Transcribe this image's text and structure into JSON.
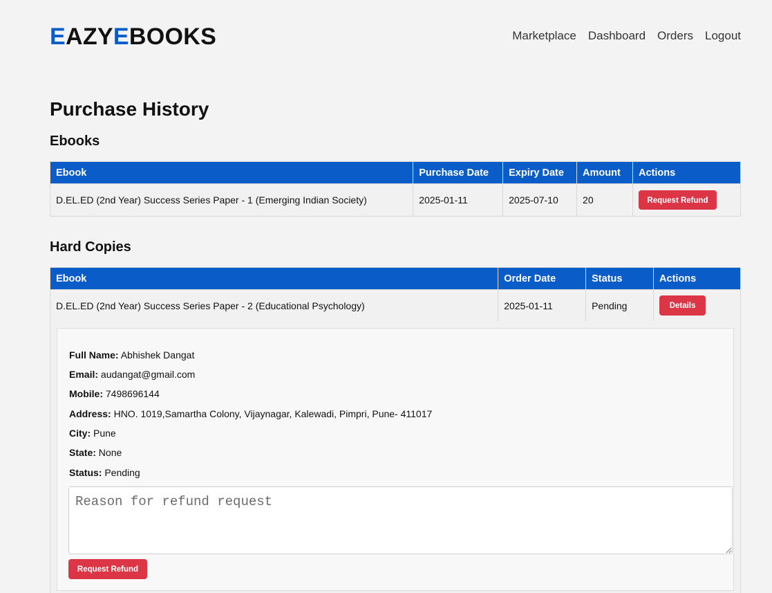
{
  "brand": {
    "logo_e1": "E",
    "logo_mid1": "AZY",
    "logo_e2": "E",
    "logo_mid2": "BOOKS",
    "accent_color": "#0a5cc9"
  },
  "nav": {
    "items": [
      "Marketplace",
      "Dashboard",
      "Orders",
      "Logout"
    ]
  },
  "page_title": "Purchase History",
  "ebooks": {
    "heading": "Ebooks",
    "columns": [
      "Ebook",
      "Purchase Date",
      "Expiry Date",
      "Amount",
      "Actions"
    ],
    "rows": [
      {
        "ebook": "D.EL.ED (2nd Year) Success Series Paper - 1 (Emerging Indian Society)",
        "purchase_date": "2025-01-11",
        "expiry_date": "2025-07-10",
        "amount": "20",
        "action_label": "Request Refund"
      }
    ]
  },
  "hard_copies": {
    "heading": "Hard Copies",
    "columns": [
      "Ebook",
      "Order Date",
      "Status",
      "Actions"
    ],
    "rows": [
      {
        "ebook": "D.EL.ED (2nd Year) Success Series Paper - 2 (Educational Psychology)",
        "order_date": "2025-01-11",
        "status": "Pending",
        "action_label": "Details"
      }
    ],
    "details": {
      "full_name_label": "Full Name:",
      "full_name": "Abhishek Dangat",
      "email_label": "Email:",
      "email": "audangat@gmail.com",
      "mobile_label": "Mobile:",
      "mobile": "7498696144",
      "address_label": "Address:",
      "address": "HNO. 1019,Samartha Colony, Vijaynagar, Kalewadi, Pimpri, Pune- 411017",
      "city_label": "City:",
      "city": "Pune",
      "state_label": "State:",
      "state": "None",
      "status_label": "Status:",
      "status": "Pending",
      "reason_placeholder": "Reason for refund request",
      "refund_button": "Request Refund"
    }
  },
  "colors": {
    "header_blue": "#0a5cc9",
    "danger_red": "#dc3545"
  }
}
